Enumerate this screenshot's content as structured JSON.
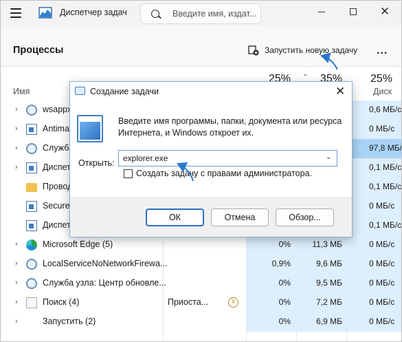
{
  "titlebar": {
    "title": "Диспетчер задач",
    "search_placeholder": "Введите имя, издат..."
  },
  "header": {
    "page_title": "Процессы",
    "run_new_task": "Запустить новую задачу",
    "more": "..."
  },
  "columns": {
    "name": "Имя",
    "disk": "Диск",
    "cpu_pct": "25%",
    "mem_pct": "35%",
    "disk_pct": "25%"
  },
  "rows": [
    {
      "name": "wsappx",
      "status": "",
      "cpu": "",
      "mem": "",
      "disk": "0,6 МБ/с",
      "icon": "gear-icon",
      "expand": true,
      "disk_highlight": false
    },
    {
      "name": "Antima",
      "status": "",
      "cpu": "",
      "mem": "",
      "disk": "0 МБ/с",
      "icon": "app-window-icon",
      "expand": true,
      "disk_highlight": false
    },
    {
      "name": "Служба",
      "status": "",
      "cpu": "",
      "mem": "",
      "disk": "97,8 МБ/с",
      "icon": "gear-icon",
      "expand": true,
      "disk_highlight": true
    },
    {
      "name": "Диспет",
      "status": "",
      "cpu": "",
      "mem": "",
      "disk": "0,1 МБ/с",
      "icon": "task-manager-icon",
      "expand": true,
      "disk_highlight": false
    },
    {
      "name": "Провод",
      "status": "",
      "cpu": "",
      "mem": "",
      "disk": "0,1 МБ/с",
      "icon": "folder-icon",
      "expand": false,
      "disk_highlight": false
    },
    {
      "name": "Secure",
      "status": "",
      "cpu": "",
      "mem": "",
      "disk": "0 МБ/с",
      "icon": "app-window-icon",
      "expand": false,
      "disk_highlight": false
    },
    {
      "name": "Диспет",
      "status": "",
      "cpu": "",
      "mem": "",
      "disk": "0,1 МБ/с",
      "icon": "app-window-icon",
      "expand": false,
      "disk_highlight": false
    },
    {
      "name": "Microsoft Edge (5)",
      "status": "",
      "cpu": "0%",
      "mem": "11,3 МБ",
      "disk": "0 МБ/с",
      "icon": "edge-icon",
      "expand": true,
      "disk_highlight": false
    },
    {
      "name": "LocalServiceNoNetworkFirewa...",
      "status": "",
      "cpu": "0,9%",
      "mem": "9,6 МБ",
      "disk": "0 МБ/с",
      "icon": "gear-icon",
      "expand": true,
      "disk_highlight": false
    },
    {
      "name": "Служба узла: Центр обновле...",
      "status": "",
      "cpu": "0%",
      "mem": "9,5 МБ",
      "disk": "0 МБ/с",
      "icon": "gear-icon",
      "expand": true,
      "disk_highlight": false
    },
    {
      "name": "Поиск (4)",
      "status": "Приоста...",
      "cpu": "0%",
      "mem": "7,2 МБ",
      "disk": "0 МБ/с",
      "icon": "search-app-icon",
      "expand": true,
      "disk_highlight": false
    },
    {
      "name": "Запустить (2)",
      "status": "",
      "cpu": "0%",
      "mem": "6,9 МБ",
      "disk": "0 МБ/с",
      "icon": "none",
      "expand": true,
      "disk_highlight": false
    }
  ],
  "dialog": {
    "title": "Создание задачи",
    "message": "Введите имя программы, папки, документа или ресурса Интернета, и Windows откроет их.",
    "open_label": "Открыть:",
    "open_value": "explorer.exe",
    "admin_checkbox": "Создать задачу с правами администратора.",
    "ok": "ОК",
    "cancel": "Отмена",
    "browse": "Обзор..."
  },
  "colors": {
    "accent": "#2d6fcc",
    "cpu_bg": "#ddeefc",
    "disk_highlight": "#a9d3f5",
    "annotation_arrow": "#2a78c8"
  }
}
